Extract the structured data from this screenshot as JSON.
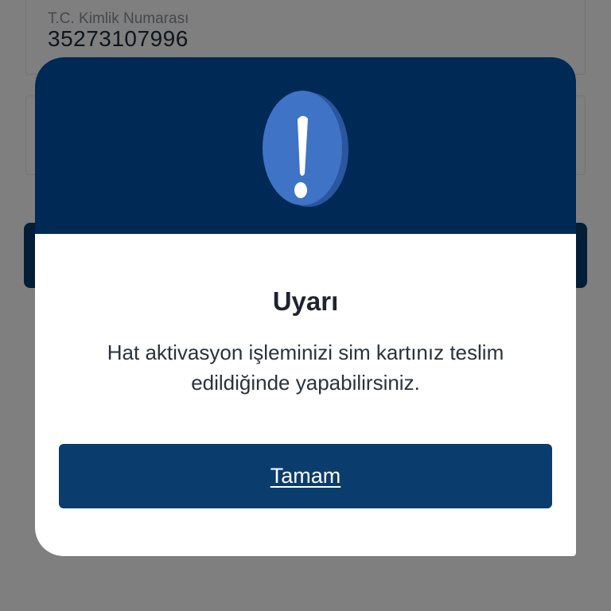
{
  "form": {
    "id_field": {
      "label": "T.C. Kimlik Numarası",
      "value": "35273107996"
    }
  },
  "modal": {
    "icon": "exclamation-icon",
    "title": "Uyarı",
    "message": "Hat aktivasyon işleminizi sim kartınız teslim edildiğinde yapabilirsiniz.",
    "ok_label": "Tamam"
  },
  "colors": {
    "header_bg": "#002a55",
    "button_bg": "#0b3c6e",
    "icon_face": "#3f73c6",
    "icon_side": "#2a56a0"
  }
}
